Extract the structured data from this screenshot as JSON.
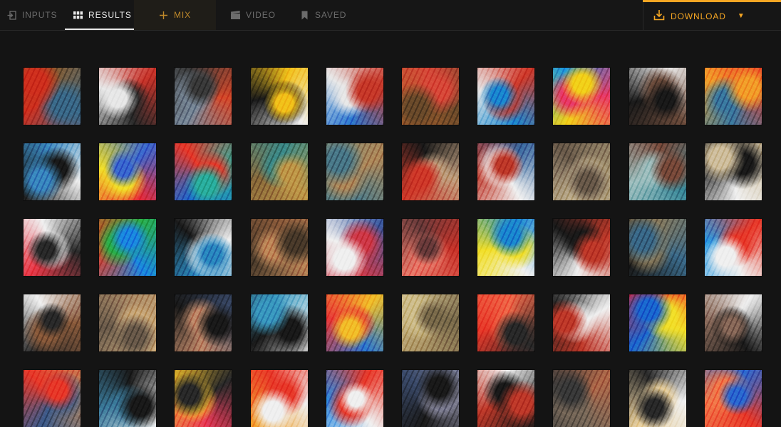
{
  "tabs": {
    "inputs": {
      "label": "INPUTS",
      "icon": "input-arrow-icon"
    },
    "results": {
      "label": "RESULTS",
      "icon": "grid-icon"
    },
    "mix": {
      "label": "MIX",
      "icon": "plus-icon"
    },
    "video": {
      "label": "VIDEO",
      "icon": "film-icon"
    },
    "saved": {
      "label": "SAVED",
      "icon": "bookmark-icon"
    }
  },
  "download": {
    "label": "DOWNLOAD",
    "icon": "download-icon",
    "caret": "caret-down-icon"
  },
  "colors": {
    "accent": "#f5a623",
    "background": "#141414",
    "tab_active": "#e8e8e8",
    "tab_inactive": "#6c6c6c"
  },
  "results": {
    "columns": 10,
    "visible_rows": 5,
    "tiles": [
      [
        "#8a5a2a",
        "#3a6a8a",
        "#d0301e"
      ],
      [
        "#c8342a",
        "#2a2a2a",
        "#e8e8e8"
      ],
      [
        "#d64a2a",
        "#7a8a9a",
        "#3a3a3a"
      ],
      [
        "#f0f0f0",
        "#1a1a1a",
        "#f2c21a"
      ],
      [
        "#2a7ad0",
        "#e8e8e8",
        "#c83a2a"
      ],
      [
        "#b0602a",
        "#d84a3a",
        "#6a4a2a"
      ],
      [
        "#e8e8e8",
        "#d03a2a",
        "#1a8ad0"
      ],
      [
        "#1a9ae0",
        "#e83a6a",
        "#f2d21a"
      ],
      [
        "#f0f0f0",
        "#6a4a3a",
        "#1a1a1a"
      ],
      [
        "#e83a2a",
        "#3a7aa0",
        "#f2a02a"
      ],
      [
        "#f0f0f0",
        "#1a1a1a",
        "#3a8ac0"
      ],
      [
        "#e82a3a",
        "#f2e02a",
        "#3a6ad0"
      ],
      [
        "#1a6ad0",
        "#e83a2a",
        "#2ab0a0"
      ],
      [
        "#8a6a3a",
        "#3a8a8a",
        "#c09a4a"
      ],
      [
        "#7a8a7a",
        "#b08a5a",
        "#4a7a8a"
      ],
      [
        "#1a1a1a",
        "#c0a080",
        "#d03a2a"
      ],
      [
        "#3a6aa0",
        "#f0f0f0",
        "#c03a2a"
      ],
      [
        "#a09070",
        "#c0b090",
        "#6a5a4a"
      ],
      [
        "#3a8a9a",
        "#a0c0c0",
        "#7a4a3a"
      ],
      [
        "#f0f0f0",
        "#1a1a1a",
        "#d0c0a0"
      ],
      [
        "#e83a4a",
        "#f0f0f0",
        "#2a2a2a"
      ],
      [
        "#f23a1a",
        "#2ab04a",
        "#1a8ae0"
      ],
      [
        "#1a1a1a",
        "#f0f0f0",
        "#2a8ac0"
      ],
      [
        "#8a5a3a",
        "#c08a5a",
        "#4a3a2a"
      ],
      [
        "#3a5aa0",
        "#d03a4a",
        "#f0f0f0"
      ],
      [
        "#c8342a",
        "#e87a6a",
        "#6a3a3a"
      ],
      [
        "#f0f0f0",
        "#f2e02a",
        "#1a8ad0"
      ],
      [
        "#f0f0f0",
        "#1a1a1a",
        "#c03a2a"
      ],
      [
        "#1a1a1a",
        "#8a7a5a",
        "#3a6a8a"
      ],
      [
        "#2a9ae0",
        "#e83a2a",
        "#f0f0f0"
      ],
      [
        "#f0f0f0",
        "#8a5a3a",
        "#2a2a2a"
      ],
      [
        "#b0906a",
        "#d0b080",
        "#6a5a4a"
      ],
      [
        "#3a4a6a",
        "#c08a6a",
        "#1a1a1a"
      ],
      [
        "#f0f0f0",
        "#1a1a1a",
        "#3a9ac0"
      ],
      [
        "#2a7ad0",
        "#e83a3a",
        "#f2c02a"
      ],
      [
        "#b09a6a",
        "#d0c090",
        "#7a6a4a"
      ],
      [
        "#e83a2a",
        "#f06a4a",
        "#2a2a2a"
      ],
      [
        "#1a1a1a",
        "#f0f0f0",
        "#c03a2a"
      ],
      [
        "#e81a2a",
        "#f2e02a",
        "#1a6ad0"
      ],
      [
        "#f0f0f0",
        "#1a1a1a",
        "#8a6a5a"
      ],
      [
        "#c08a5a",
        "#3a5a8a",
        "#e83a2a"
      ],
      [
        "#f0f0f0",
        "#3a7a9a",
        "#1a1a1a"
      ],
      [
        "#e83a5a",
        "#f2c02a",
        "#2a2a2a"
      ],
      [
        "#f2a02a",
        "#e83a2a",
        "#f0f0f0"
      ],
      [
        "#2a8ae0",
        "#e83a2a",
        "#f0f0f0"
      ],
      [
        "#3a4a6a",
        "#8a8aa0",
        "#1a1a1a"
      ],
      [
        "#f0f0f0",
        "#1a1a1a",
        "#c03a2a"
      ],
      [
        "#b06a4a",
        "#7a6a5a",
        "#3a3a3a"
      ],
      [
        "#f0f0f0",
        "#e8d0a0",
        "#2a2a2a"
      ],
      [
        "#e83a2a",
        "#f27a4a",
        "#2a6ad0"
      ]
    ]
  }
}
